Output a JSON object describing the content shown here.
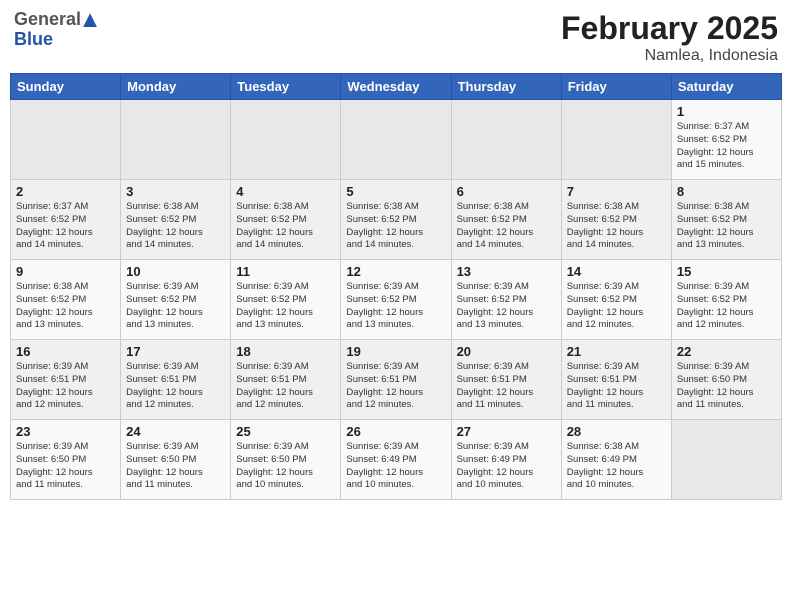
{
  "header": {
    "logo_general": "General",
    "logo_blue": "Blue",
    "title": "February 2025",
    "subtitle": "Namlea, Indonesia"
  },
  "weekdays": [
    "Sunday",
    "Monday",
    "Tuesday",
    "Wednesday",
    "Thursday",
    "Friday",
    "Saturday"
  ],
  "weeks": [
    [
      {
        "day": "",
        "info": ""
      },
      {
        "day": "",
        "info": ""
      },
      {
        "day": "",
        "info": ""
      },
      {
        "day": "",
        "info": ""
      },
      {
        "day": "",
        "info": ""
      },
      {
        "day": "",
        "info": ""
      },
      {
        "day": "1",
        "info": "Sunrise: 6:37 AM\nSunset: 6:52 PM\nDaylight: 12 hours\nand 15 minutes."
      }
    ],
    [
      {
        "day": "2",
        "info": "Sunrise: 6:37 AM\nSunset: 6:52 PM\nDaylight: 12 hours\nand 14 minutes."
      },
      {
        "day": "3",
        "info": "Sunrise: 6:38 AM\nSunset: 6:52 PM\nDaylight: 12 hours\nand 14 minutes."
      },
      {
        "day": "4",
        "info": "Sunrise: 6:38 AM\nSunset: 6:52 PM\nDaylight: 12 hours\nand 14 minutes."
      },
      {
        "day": "5",
        "info": "Sunrise: 6:38 AM\nSunset: 6:52 PM\nDaylight: 12 hours\nand 14 minutes."
      },
      {
        "day": "6",
        "info": "Sunrise: 6:38 AM\nSunset: 6:52 PM\nDaylight: 12 hours\nand 14 minutes."
      },
      {
        "day": "7",
        "info": "Sunrise: 6:38 AM\nSunset: 6:52 PM\nDaylight: 12 hours\nand 14 minutes."
      },
      {
        "day": "8",
        "info": "Sunrise: 6:38 AM\nSunset: 6:52 PM\nDaylight: 12 hours\nand 13 minutes."
      }
    ],
    [
      {
        "day": "9",
        "info": "Sunrise: 6:38 AM\nSunset: 6:52 PM\nDaylight: 12 hours\nand 13 minutes."
      },
      {
        "day": "10",
        "info": "Sunrise: 6:39 AM\nSunset: 6:52 PM\nDaylight: 12 hours\nand 13 minutes."
      },
      {
        "day": "11",
        "info": "Sunrise: 6:39 AM\nSunset: 6:52 PM\nDaylight: 12 hours\nand 13 minutes."
      },
      {
        "day": "12",
        "info": "Sunrise: 6:39 AM\nSunset: 6:52 PM\nDaylight: 12 hours\nand 13 minutes."
      },
      {
        "day": "13",
        "info": "Sunrise: 6:39 AM\nSunset: 6:52 PM\nDaylight: 12 hours\nand 13 minutes."
      },
      {
        "day": "14",
        "info": "Sunrise: 6:39 AM\nSunset: 6:52 PM\nDaylight: 12 hours\nand 12 minutes."
      },
      {
        "day": "15",
        "info": "Sunrise: 6:39 AM\nSunset: 6:52 PM\nDaylight: 12 hours\nand 12 minutes."
      }
    ],
    [
      {
        "day": "16",
        "info": "Sunrise: 6:39 AM\nSunset: 6:51 PM\nDaylight: 12 hours\nand 12 minutes."
      },
      {
        "day": "17",
        "info": "Sunrise: 6:39 AM\nSunset: 6:51 PM\nDaylight: 12 hours\nand 12 minutes."
      },
      {
        "day": "18",
        "info": "Sunrise: 6:39 AM\nSunset: 6:51 PM\nDaylight: 12 hours\nand 12 minutes."
      },
      {
        "day": "19",
        "info": "Sunrise: 6:39 AM\nSunset: 6:51 PM\nDaylight: 12 hours\nand 12 minutes."
      },
      {
        "day": "20",
        "info": "Sunrise: 6:39 AM\nSunset: 6:51 PM\nDaylight: 12 hours\nand 11 minutes."
      },
      {
        "day": "21",
        "info": "Sunrise: 6:39 AM\nSunset: 6:51 PM\nDaylight: 12 hours\nand 11 minutes."
      },
      {
        "day": "22",
        "info": "Sunrise: 6:39 AM\nSunset: 6:50 PM\nDaylight: 12 hours\nand 11 minutes."
      }
    ],
    [
      {
        "day": "23",
        "info": "Sunrise: 6:39 AM\nSunset: 6:50 PM\nDaylight: 12 hours\nand 11 minutes."
      },
      {
        "day": "24",
        "info": "Sunrise: 6:39 AM\nSunset: 6:50 PM\nDaylight: 12 hours\nand 11 minutes."
      },
      {
        "day": "25",
        "info": "Sunrise: 6:39 AM\nSunset: 6:50 PM\nDaylight: 12 hours\nand 10 minutes."
      },
      {
        "day": "26",
        "info": "Sunrise: 6:39 AM\nSunset: 6:49 PM\nDaylight: 12 hours\nand 10 minutes."
      },
      {
        "day": "27",
        "info": "Sunrise: 6:39 AM\nSunset: 6:49 PM\nDaylight: 12 hours\nand 10 minutes."
      },
      {
        "day": "28",
        "info": "Sunrise: 6:38 AM\nSunset: 6:49 PM\nDaylight: 12 hours\nand 10 minutes."
      },
      {
        "day": "",
        "info": ""
      }
    ]
  ]
}
